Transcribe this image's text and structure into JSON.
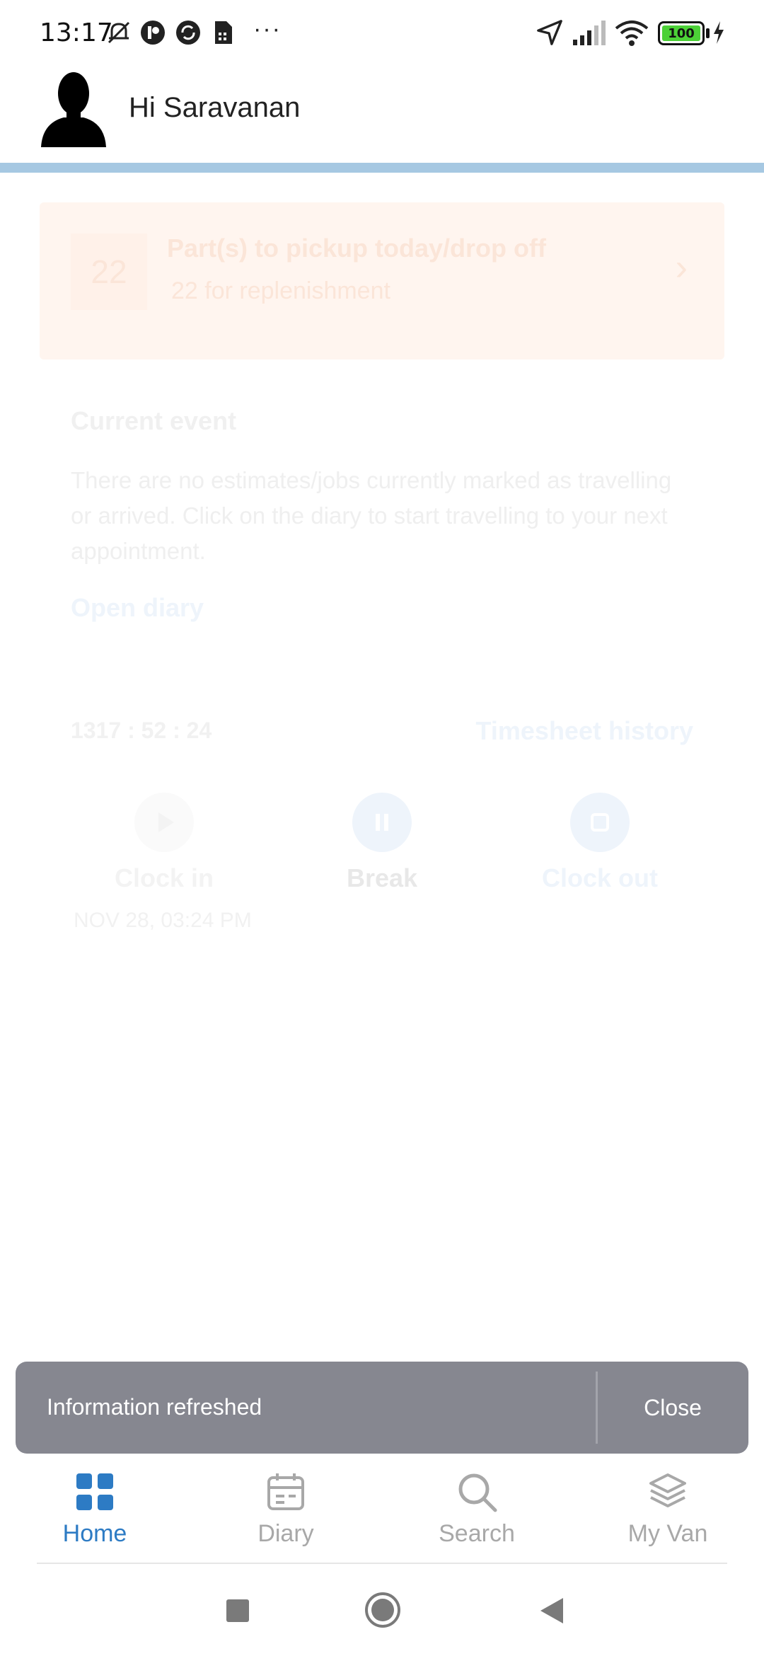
{
  "status_bar": {
    "time": "13:17",
    "battery": "100",
    "more": "···"
  },
  "header": {
    "greeting": "Hi Saravanan"
  },
  "parts_card": {
    "count": "22",
    "title": "Part(s) to pickup today/drop off",
    "subtitle": "22 for replenishment"
  },
  "current_event": {
    "title": "Current event",
    "text": "There are no estimates/jobs currently marked as travelling or arrived. Click on the diary to start travelling to your next appointment.",
    "link": "Open diary"
  },
  "timesheet": {
    "timer": "1317 : 52 : 24",
    "history_link": "Timesheet history",
    "clock_in": "Clock in",
    "clock_in_time": "NOV 28, 03:24 PM",
    "break": "Break",
    "clock_out": "Clock out"
  },
  "snackbar": {
    "message": "Information refreshed",
    "action": "Close"
  },
  "bottom_nav": {
    "items": [
      {
        "label": "Home",
        "icon": "grid-icon",
        "active": true
      },
      {
        "label": "Diary",
        "icon": "calendar-icon",
        "active": false
      },
      {
        "label": "Search",
        "icon": "search-icon",
        "active": false
      },
      {
        "label": "My Van",
        "icon": "layers-icon",
        "active": false
      }
    ]
  },
  "colors": {
    "accent": "#2d7bc4",
    "inactive": "#a8a8a8",
    "snackbar": "#868790",
    "header_bar": "#a6c8e2"
  }
}
